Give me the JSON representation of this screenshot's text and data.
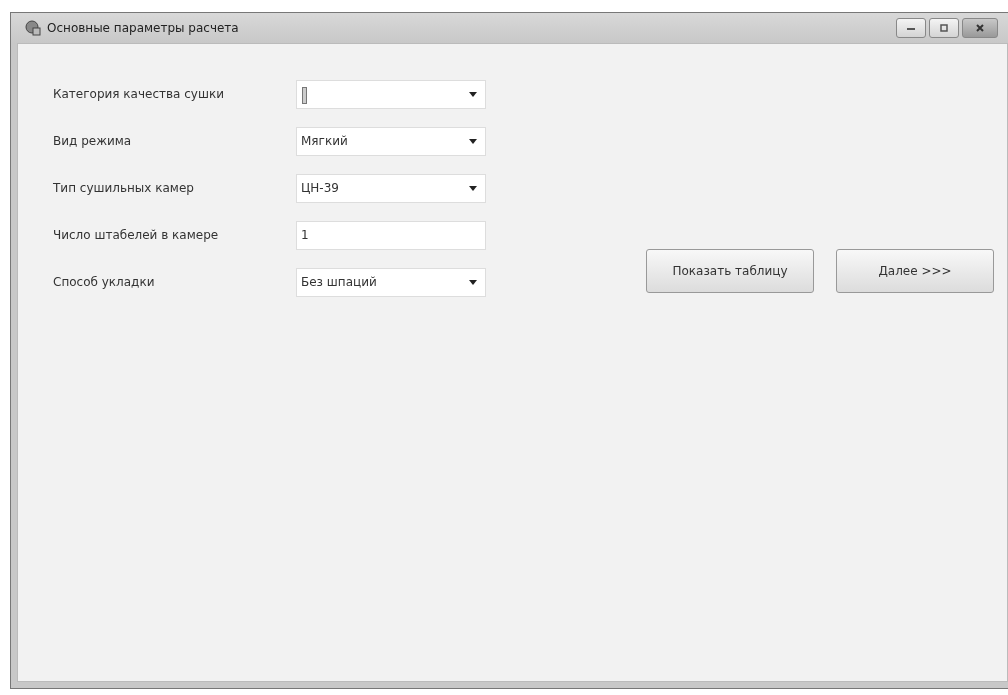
{
  "window": {
    "title": "Основные параметры расчета"
  },
  "fields": [
    {
      "label": "Категория качества сушки",
      "kind": "combo",
      "focused": true
    },
    {
      "label": "Вид режима",
      "kind": "combo",
      "value": "Мягкий",
      "focused": false
    },
    {
      "label": "Тип сушильных камер",
      "kind": "combo",
      "value": "ЦН-39",
      "focused": false
    },
    {
      "label": "Число штабелей в камере",
      "kind": "text",
      "value": "1",
      "focused": false
    },
    {
      "label": "Способ укладки",
      "kind": "combo",
      "value": "Без шпаций",
      "focused": false
    }
  ],
  "buttons": [
    "Показать таблицу",
    "Далее >>>"
  ]
}
